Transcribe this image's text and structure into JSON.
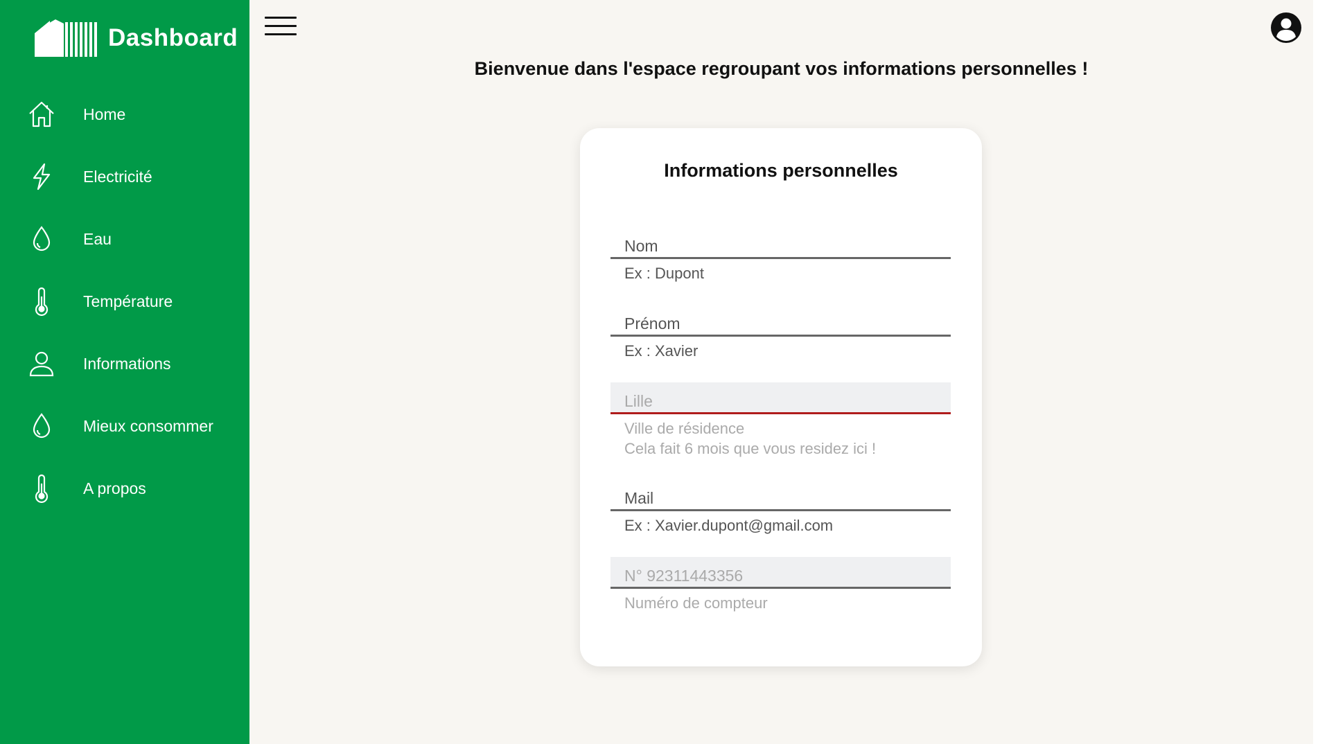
{
  "brand": {
    "title": "Dashboard"
  },
  "sidebar": {
    "items": [
      {
        "label": "Home",
        "icon": "home-icon"
      },
      {
        "label": "Electricité",
        "icon": "lightning-icon"
      },
      {
        "label": "Eau",
        "icon": "drop-icon"
      },
      {
        "label": "Température",
        "icon": "thermometer-icon"
      },
      {
        "label": "Informations",
        "icon": "user-icon"
      },
      {
        "label": "Mieux consommer",
        "icon": "drop-icon"
      },
      {
        "label": "A propos",
        "icon": "thermometer-icon"
      }
    ]
  },
  "header": {
    "welcome": "Bienvenue dans l'espace regroupant vos informations personnelles !"
  },
  "form": {
    "title": "Informations personnelles",
    "nom": {
      "value": "Nom",
      "helper": "Ex : Dupont"
    },
    "prenom": {
      "value": "Prénom",
      "helper": "Ex : Xavier"
    },
    "ville": {
      "value": "Lille",
      "helper": "Ville de résidence",
      "helper2": "Cela fait 6 mois que vous residez ici !"
    },
    "mail": {
      "value": "Mail",
      "helper": "Ex : Xavier.dupont@gmail.com"
    },
    "compteur": {
      "value": "N° 92311443356",
      "helper": "Numéro de compteur"
    }
  },
  "colors": {
    "sidebar": "#019a48",
    "background": "#f8f6f2",
    "error_underline": "#b01c1c"
  }
}
